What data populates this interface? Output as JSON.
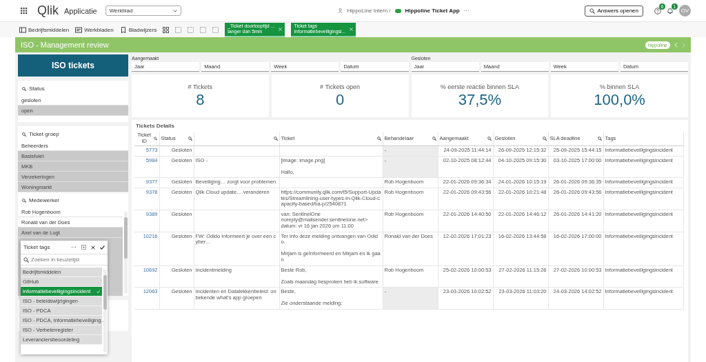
{
  "top_bar": {
    "logo": "Qlik",
    "app_label": "Applicatie",
    "sheet_select": "Werkblad",
    "space": "HippoLine Intern /",
    "app_name": "Hippoline Ticket App",
    "more": "···",
    "answers_button": "Answers openen",
    "help_badge": "6",
    "notification_badge": "1",
    "avatar": "OV"
  },
  "toolbar": {
    "buttons": [
      {
        "label": "Bedrijfsmiddelen",
        "kind": "panel"
      },
      {
        "label": "Werkbladen",
        "kind": "sheets"
      },
      {
        "label": "Bladwijzers",
        "kind": "bookmark"
      }
    ]
  },
  "selections": [
    {
      "field": "_Ticket doorlooptijd ...",
      "value": "langer dan 5min"
    },
    {
      "field": "Ticket tags",
      "value": "Informatiebeveiligingsi..."
    }
  ],
  "sheet": {
    "title": "ISO - Management review",
    "logo": "hippoline"
  },
  "left_panel": {
    "title": "ISO tickets",
    "filters": [
      {
        "label": "Status",
        "items": [
          {
            "label": "gesloten",
            "excluded": false
          },
          {
            "label": "open",
            "excluded": true
          }
        ]
      },
      {
        "label": "Ticket groep",
        "items": [
          {
            "label": "Beheerders",
            "excluded": false
          },
          {
            "label": "Basisfuiet",
            "excluded": true
          },
          {
            "label": "MKB",
            "excluded": true
          },
          {
            "label": "Verzekeringen",
            "excluded": true
          },
          {
            "label": "Woningmarkt",
            "excluded": true
          }
        ]
      },
      {
        "label": "Medewerker",
        "items": [
          {
            "label": "Rob Hogenboom",
            "excluded": false
          },
          {
            "label": "Ronald van der Does",
            "excluded": false
          },
          {
            "label": "Axel van de Logt",
            "excluded": true
          }
        ]
      }
    ]
  },
  "ticket_tags_popup": {
    "title": "Ticket tags",
    "more": "···",
    "search_placeholder": "Zoeken in keuzelijst",
    "items": [
      {
        "label": "Bedrijfsmiddelen",
        "selected": false
      },
      {
        "label": "GitHub",
        "selected": false
      },
      {
        "label": "Informatiebeveiligingsincident",
        "selected": true
      },
      {
        "label": "ISO - beleidswijzigingen",
        "selected": false
      },
      {
        "label": "ISO - PDCA",
        "selected": false
      },
      {
        "label": "ISO - PDCA, Informatiebeveiliging...",
        "selected": false
      },
      {
        "label": "ISO - Verbeterregister",
        "selected": false
      },
      {
        "label": "Leveranciersbeoordeling",
        "selected": false
      }
    ]
  },
  "date_filters": [
    {
      "label": "Aangemaakt",
      "fields": [
        "Jaar",
        "Maand",
        "Week",
        "Datum"
      ]
    },
    {
      "label": "Gesloten",
      "fields": [
        "Jaar",
        "Maand",
        "Week",
        "Datum"
      ]
    }
  ],
  "kpis": [
    {
      "label": "# Tickets",
      "value": "8"
    },
    {
      "label": "# Tickets open",
      "value": "0"
    },
    {
      "label": "% eerste reactie binnen SLA",
      "value": "37,5%"
    },
    {
      "label": "% binnen SLA",
      "value": "100,0%"
    }
  ],
  "table": {
    "title": "Tickets Details",
    "columns": [
      {
        "label": "Ticket ID",
        "searchable": true
      },
      {
        "label": "Status",
        "searchable": true
      },
      {
        "searchable": true
      },
      {
        "label": "Ticket",
        "searchable": true
      },
      {
        "label": "Behandelaar",
        "searchable": true
      },
      {
        "label": "Aangemaakt",
        "searchable": true
      },
      {
        "label": "Gesloten",
        "searchable": true
      },
      {
        "label": "SLA deadline",
        "searchable": true
      },
      {
        "label": "Tags",
        "searchable": false
      }
    ],
    "rows": [
      {
        "id": "5773",
        "status": "Gesloten",
        "assignee": "-",
        "assignee_null": true,
        "created": "24-09-2025 11:44:14",
        "closed": "26-09-2025 12:15:32",
        "sla": "25-09-2025 15:44:15",
        "tags": "Informatiebeveiligingsincident"
      },
      {
        "id": "5984",
        "status": "Gesloten",
        "subject": "ISO -",
        "ticket": "[image: image.png]\n\nHallo,",
        "assignee": "-",
        "assignee_null": true,
        "created": "02-10-2025 08:12:44",
        "closed": "04-10-2025 09:15:30",
        "sla": "03-10-2025 17:00:00",
        "tags": "Informatiebeveiligingsincident"
      },
      {
        "id": "9377",
        "status": "Gesloten",
        "subject": "Beveiliging… zorgt voor problemen",
        "assignee": "Rob Hogenboom",
        "assignee_null": false,
        "created": "22-01-2026 09:36:34",
        "closed": "24-01-2026 10:15:19",
        "sla": "26-01-2026 09:36:35",
        "tags": "Informatiebeveiligingsincident"
      },
      {
        "id": "9378",
        "status": "Gesloten",
        "subject": "Qlik Cloud update… veranderen",
        "ticket": "https://community.qlik.com/t5/Support-Updates/Streamlining-user-types-in-Qlik-Cloud-capacity-based/ba-p/2540871",
        "assignee": "Rob Hogenboom",
        "assignee_null": false,
        "created": "22-01-2026 09:43:56",
        "closed": "22-01-2026 10:21:48",
        "sla": "26-01-2026 09:43:56",
        "tags": "Informatiebeveiligingsincident"
      },
      {
        "id": "9389",
        "status": "Gesloten",
        "ticket": "van: SentinelOne\nnoreply@mailsender.sentinelone.net>\ndatum: vr 16 jan 2026 om 11:00",
        "assignee": "Rob Hogenboom",
        "assignee_null": false,
        "created": "22-01-2026 14:40:50",
        "closed": "22-01-2026 14:46:12",
        "sla": "26-01-2026 14:41:20",
        "tags": "Informatiebeveiligingsincident"
      },
      {
        "id": "10216",
        "status": "Gesloten",
        "subject": "FW: Odido informeert je over een cyber…",
        "ticket": "Ter info deze melding ontvangen van Odido.\n\nMirjam is geïnformeerd en Mirjam en ik gaan",
        "assignee": "Ronald van der Does",
        "assignee_null": false,
        "created": "12-02-2026 17:01:23",
        "closed": "16-02-2026 13:44:58",
        "sla": "16-02-2026 17:00:00",
        "tags": "Informatiebeveiligingsincident"
      },
      {
        "id": "10692",
        "status": "Gesloten",
        "subject": "Incidentmelding",
        "ticket": "Beste Rob,\n\nZoals maandag besproken heb ik software",
        "assignee": "Rob Hogenboom",
        "assignee_null": false,
        "created": "25-02-2026 10:00:53",
        "closed": "27-02-2026 11:15:26",
        "sla": "27-02-2026 10:00:53",
        "tags": "Informatiebeveiligingsincident"
      },
      {
        "id": "12063",
        "status": "Gesloten",
        "subject": "Incidenten en Datalekkenbeleid: onbekende what's app groepen",
        "ticket": "Beste,\n\nZie onderstaande melding:",
        "assignee": "-",
        "assignee_null": true,
        "created": "23-03-2026 10:02:52",
        "closed": "23-03-2026 11:03:20",
        "sla": "24-03-2026 14:02:52",
        "tags": "Informatiebeveiligingsincident"
      }
    ]
  }
}
